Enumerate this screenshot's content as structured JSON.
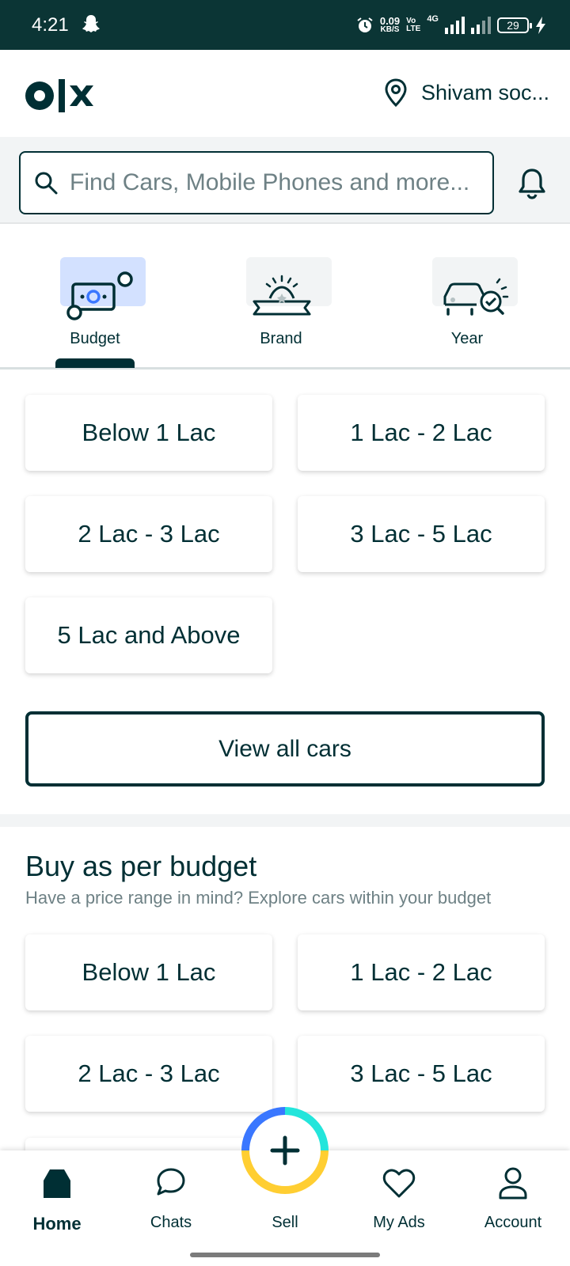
{
  "status_bar": {
    "time": "4:21",
    "speed_value": "0.09",
    "speed_unit": "KB/S",
    "volte_top": "Vo",
    "volte_bottom": "LTE",
    "network": "4G",
    "battery": "29"
  },
  "header": {
    "logo": "OLX",
    "location": "Shivam soc...",
    "location_icon": "location-pin-icon"
  },
  "search": {
    "placeholder": "Find Cars, Mobile Phones and more...",
    "icon": "search-icon",
    "notification_icon": "bell-icon"
  },
  "filter_tabs": [
    {
      "label": "Budget",
      "icon": "money-icon",
      "active": true
    },
    {
      "label": "Brand",
      "icon": "ribbon-badge-icon",
      "active": false
    },
    {
      "label": "Year",
      "icon": "car-check-icon",
      "active": false
    }
  ],
  "budget_ranges": [
    "Below 1 Lac",
    "1 Lac - 2 Lac",
    "2 Lac - 3 Lac",
    "3 Lac - 5 Lac",
    "5 Lac and Above"
  ],
  "view_all_label": "View all cars",
  "buy_section": {
    "title": "Buy as per budget",
    "subtitle": "Have a price range in mind? Explore cars within your budget",
    "ranges": [
      "Below 1 Lac",
      "1 Lac - 2 Lac",
      "2 Lac - 3 Lac",
      "3 Lac - 5 Lac"
    ]
  },
  "bottom_nav": {
    "items": [
      {
        "label": "Home",
        "icon": "home-icon",
        "active": true
      },
      {
        "label": "Chats",
        "icon": "chat-icon",
        "active": false
      },
      {
        "label": "Sell",
        "icon": "plus-icon",
        "active": false
      },
      {
        "label": "My Ads",
        "icon": "heart-icon",
        "active": false
      },
      {
        "label": "Account",
        "icon": "account-icon",
        "active": false
      }
    ]
  },
  "colors": {
    "primary": "#002f34",
    "status_bar": "#0b3535",
    "active_tile": "#d3e1ff",
    "sell_blue": "#3a77ff",
    "sell_teal": "#23e5db",
    "sell_yellow": "#ffce32"
  }
}
